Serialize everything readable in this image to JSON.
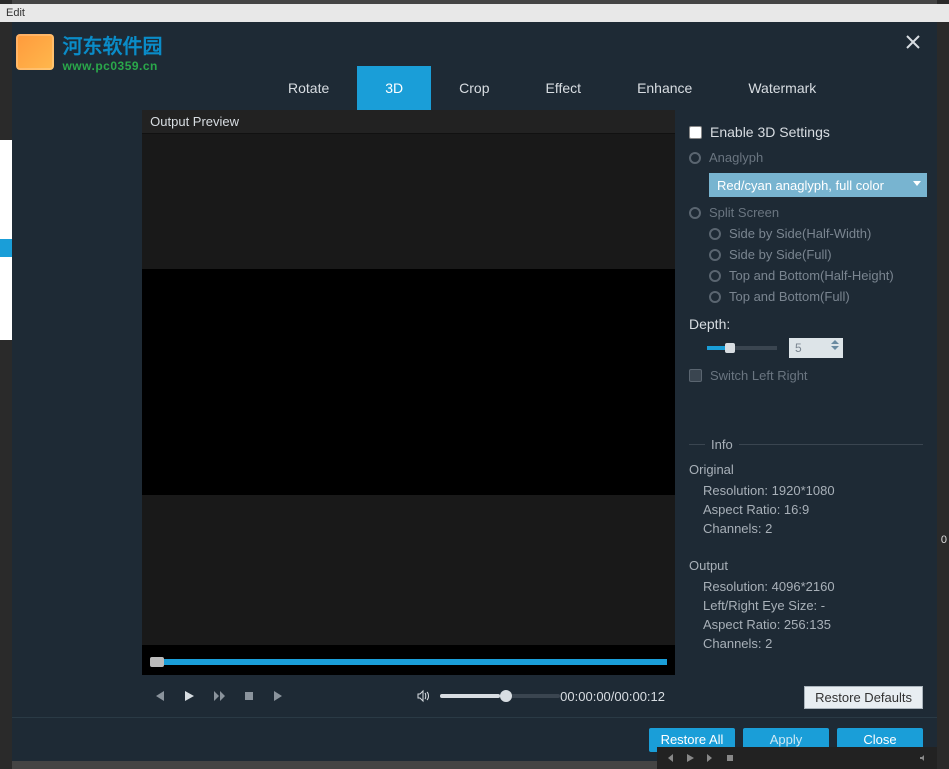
{
  "titlebar": {
    "label": "Edit"
  },
  "watermark": {
    "title": "河东软件园",
    "url": "www.pc0359.cn"
  },
  "tabs": {
    "rotate": "Rotate",
    "threed": "3D",
    "crop": "Crop",
    "effect": "Effect",
    "enhance": "Enhance",
    "watermark": "Watermark"
  },
  "preview": {
    "label": "Output Preview"
  },
  "player": {
    "time": "00:00:00/00:00:12"
  },
  "panel": {
    "enable_label": "Enable 3D Settings",
    "anaglyph_label": "Anaglyph",
    "anaglyph_option": "Red/cyan anaglyph, full color",
    "split_label": "Split Screen",
    "opt_sbs_half": "Side by Side(Half-Width)",
    "opt_sbs_full": "Side by Side(Full)",
    "opt_tb_half": "Top and Bottom(Half-Height)",
    "opt_tb_full": "Top and Bottom(Full)",
    "depth_label": "Depth:",
    "depth_value": "5",
    "switch_label": "Switch Left Right",
    "info_header": "Info",
    "original": {
      "title": "Original",
      "resolution": "Resolution: 1920*1080",
      "aspect": "Aspect Ratio: 16:9",
      "channels": "Channels: 2"
    },
    "output": {
      "title": "Output",
      "resolution": "Resolution: 4096*2160",
      "eye": "Left/Right Eye Size: -",
      "aspect": "Aspect Ratio: 256:135",
      "channels": "Channels: 2"
    },
    "restore_defaults": "Restore Defaults"
  },
  "footer": {
    "restore_all": "Restore All",
    "apply": "Apply",
    "close": "Close"
  },
  "bg": {
    "num": "0"
  }
}
